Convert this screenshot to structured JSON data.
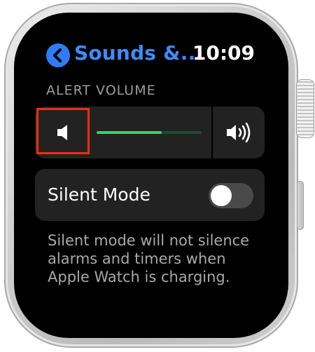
{
  "header": {
    "back_title": "Sounds &...",
    "time": "10:09"
  },
  "alert_volume": {
    "label": "ALERT VOLUME",
    "level_percent": 62
  },
  "silent_mode": {
    "label": "Silent Mode",
    "enabled": false
  },
  "footnote": "Silent mode will not silence alarms and timers when Apple Watch is charging.",
  "colors": {
    "accent_blue": "#3e8bff",
    "slider_green": "#2fd46e",
    "highlight_red": "#ff2a12"
  },
  "icons": [
    "chevron-left-icon",
    "speaker-low-icon",
    "speaker-high-icon"
  ]
}
